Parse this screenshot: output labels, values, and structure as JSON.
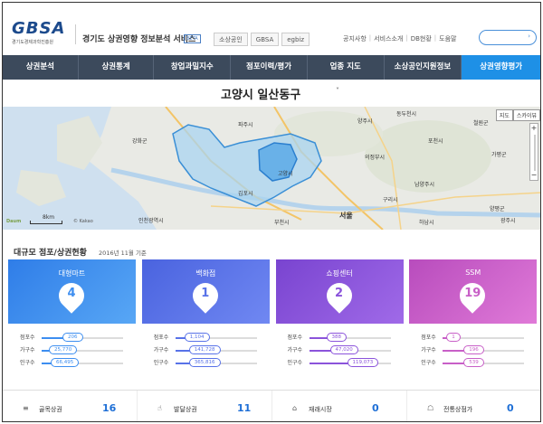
{
  "header": {
    "logo_text": "GBSA",
    "logo_sub": "경기도경제과학진흥원",
    "service_title": "경기도 상권영향 정보분석 서비스",
    "beta": "BETA",
    "partners": [
      "소상공인",
      "GBSA",
      "egbiz"
    ],
    "util_links": [
      "공지사항",
      "서비스소개",
      "DB현황",
      "도움말"
    ],
    "search_caret": "›"
  },
  "nav": {
    "items": [
      "상권분석",
      "상권통계",
      "창업과밀지수",
      "점포이력/평가",
      "업종 지도",
      "소상공인지원정보",
      "상권영향평가"
    ],
    "active_index": 6
  },
  "region": {
    "name": "고양시 일산동구",
    "caret": "˅"
  },
  "map": {
    "type_buttons": [
      "지도",
      "스카이뷰"
    ],
    "scale_label": "8km",
    "provider": "Daum",
    "copyright": "© Kakao",
    "zoom_plus": "+",
    "zoom_minus": "−",
    "place_labels": [
      "양주시",
      "동두천시",
      "파주시",
      "강화군",
      "의정부시",
      "남양주시",
      "김포시",
      "고양시",
      "구리시",
      "서울",
      "하남시",
      "양평군",
      "인천광역시",
      "광주시",
      "부천시",
      "포천시",
      "가평군",
      "철원군"
    ]
  },
  "section": {
    "title": "대규모 점포/상권현황",
    "date": "2016년 11월 기준"
  },
  "cards": [
    {
      "label": "대형마트",
      "count": "4",
      "color": "#3d8ef0",
      "grad_from": "#2f7de8",
      "grad_to": "#58a7f5",
      "stats": [
        {
          "label": "점포수",
          "value": "206",
          "fraction": 0.35
        },
        {
          "label": "가구수",
          "value": "25,770",
          "fraction": 0.18
        },
        {
          "label": "인구수",
          "value": "66,495",
          "fraction": 0.2
        }
      ]
    },
    {
      "label": "백화점",
      "count": "1",
      "color": "#5872e8",
      "grad_from": "#4a63df",
      "grad_to": "#7088f2",
      "stats": [
        {
          "label": "점포수",
          "value": "1,104",
          "fraction": 0.2
        },
        {
          "label": "가구수",
          "value": "141,728",
          "fraction": 0.25
        },
        {
          "label": "인구수",
          "value": "365,816",
          "fraction": 0.25
        }
      ]
    },
    {
      "label": "쇼핑센터",
      "count": "2",
      "color": "#8b53db",
      "grad_from": "#7944d0",
      "grad_to": "#a06ae8",
      "stats": [
        {
          "label": "점포수",
          "value": "388",
          "fraction": 0.3
        },
        {
          "label": "가구수",
          "value": "47,020",
          "fraction": 0.35
        },
        {
          "label": "인구수",
          "value": "119,073",
          "fraction": 0.55
        }
      ]
    },
    {
      "label": "SSM",
      "count": "19",
      "color": "#c85fc7",
      "grad_from": "#b84cbd",
      "grad_to": "#e07ad8",
      "stats": [
        {
          "label": "점포수",
          "value": "1",
          "fraction": 0.05
        },
        {
          "label": "가구수",
          "value": "196",
          "fraction": 0.35
        },
        {
          "label": "인구수",
          "value": "539",
          "fraction": 0.35
        }
      ]
    }
  ],
  "summary": [
    {
      "icon": "layers-icon",
      "glyph": "≡",
      "label": "골목상권",
      "value": "16"
    },
    {
      "icon": "thumbs-up-icon",
      "glyph": "☝",
      "label": "발달상권",
      "value": "11"
    },
    {
      "icon": "market-icon",
      "glyph": "⌂",
      "label": "재래시장",
      "value": "0"
    },
    {
      "icon": "shop-icon",
      "glyph": "☖",
      "label": "전통상점가",
      "value": "0"
    }
  ]
}
